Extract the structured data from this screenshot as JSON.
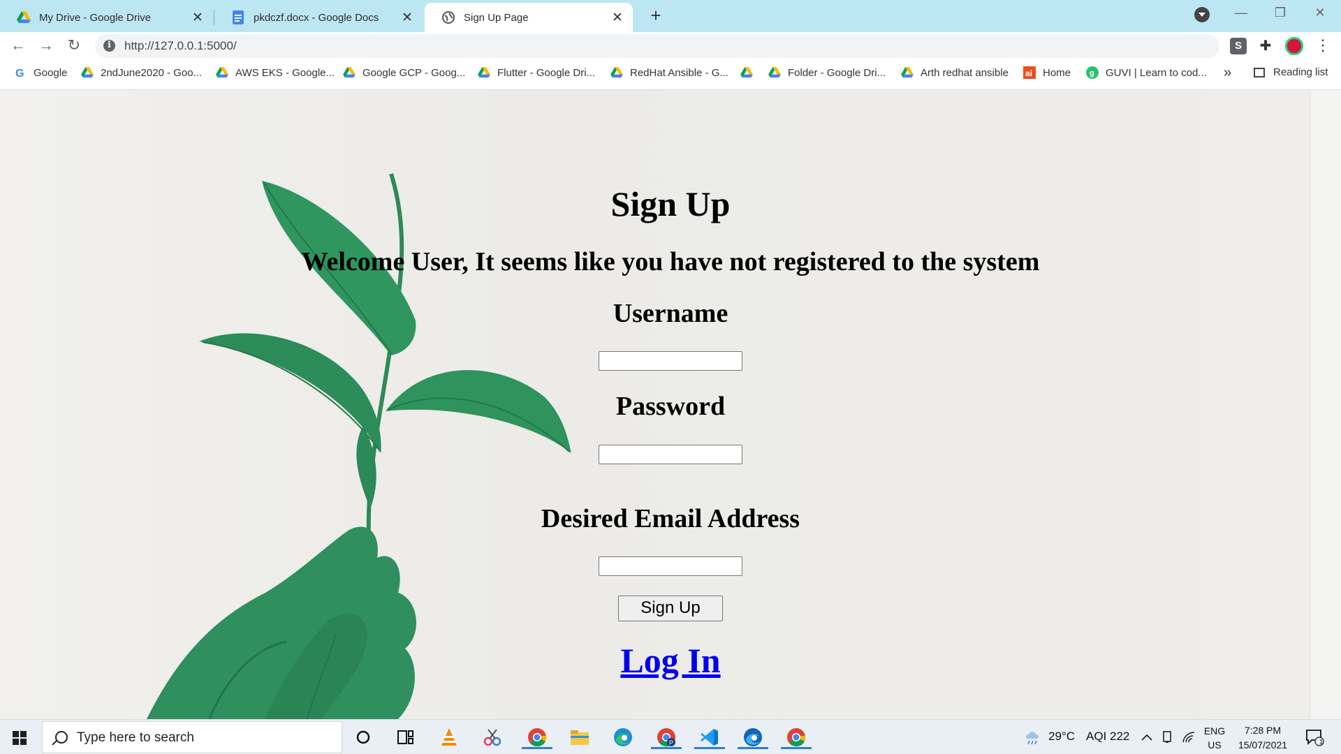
{
  "browser": {
    "tabs": [
      {
        "title": "My Drive - Google Drive",
        "icon": "google-drive-icon"
      },
      {
        "title": "pkdczf.docx - Google Docs",
        "icon": "google-docs-icon"
      },
      {
        "title": "Sign Up Page",
        "icon": "globe-icon",
        "active": true
      }
    ],
    "url": "http://127.0.0.1:5000/",
    "bookmarks": [
      {
        "label": "Google",
        "icon": "google-icon"
      },
      {
        "label": "2ndJune2020 - Goo...",
        "icon": "google-drive-icon"
      },
      {
        "label": "AWS EKS - Google...",
        "icon": "google-drive-icon"
      },
      {
        "label": "Google GCP - Goog...",
        "icon": "google-drive-icon"
      },
      {
        "label": "Flutter - Google Dri...",
        "icon": "google-drive-icon"
      },
      {
        "label": "RedHat Ansible - G...",
        "icon": "google-drive-icon"
      },
      {
        "label": "",
        "icon": "google-drive-icon"
      },
      {
        "label": "Folder - Google Dri...",
        "icon": "google-drive-icon"
      },
      {
        "label": "Arth redhat ansible",
        "icon": "google-drive-icon"
      },
      {
        "label": "Home",
        "icon": "ai-icon"
      },
      {
        "label": "GUVI | Learn to cod...",
        "icon": "guvi-icon"
      }
    ],
    "bookmarks_more": "»",
    "reading_list": "Reading list",
    "extension_s": "S"
  },
  "page": {
    "heading": "Sign Up",
    "welcome": "Welcome User, It seems like you have not registered to the system",
    "username_label": "Username",
    "password_label": "Password",
    "email_label": "Desired Email Address",
    "submit_label": "Sign Up",
    "login_link": "Log In",
    "colors": {
      "link": "#0000ee",
      "leaf_green": "#2e8b57"
    }
  },
  "taskbar": {
    "search_placeholder": "Type here to search",
    "weather": "29°C",
    "aqi": "AQI 222",
    "lang_top": "ENG",
    "lang_bottom": "US",
    "time": "7:28 PM",
    "date": "15/07/2021",
    "notification_count": "1",
    "pinned": [
      "cortana-icon",
      "task-view-icon",
      "vlc-icon",
      "snipping-tool-icon",
      "chrome-icon",
      "file-explorer-icon",
      "edge-icon",
      "chrome-profile-icon",
      "vscode-icon",
      "edge-beta-icon",
      "chrome-icon"
    ]
  }
}
